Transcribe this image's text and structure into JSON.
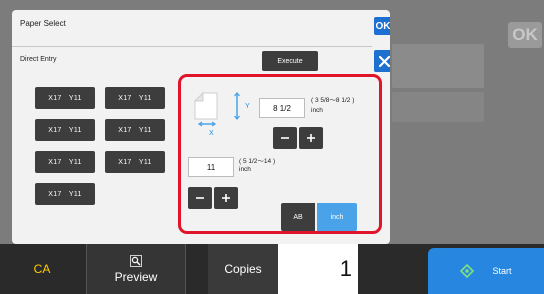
{
  "dialog": {
    "title": "Paper Select",
    "ok_label": "OK",
    "subtitle": "Direct Entry",
    "execute_label": "Execute",
    "close_icon": "close-icon",
    "presets": [
      "X17　Y11",
      "X17　Y11",
      "X17　Y11",
      "X17　Y11",
      "X17　Y11",
      "X17　Y11",
      "X17　Y11"
    ]
  },
  "entry": {
    "y_label": "Y",
    "y_value": "8 1/2",
    "y_range": "( 3 5/8～8 1/2 )",
    "y_unit": "inch",
    "x_label": "X",
    "x_value": "11",
    "x_range": "( 5 1/2～14 )",
    "x_unit": "inch",
    "minus_icon": "minus-icon",
    "plus_icon": "plus-icon",
    "unit_ab": "AB",
    "unit_inch": "inch",
    "selected_unit": "inch"
  },
  "background": {
    "ok_label": "OK"
  },
  "bottom": {
    "ca_label": "CA",
    "preview_label": "Preview",
    "preview_icon": "magnifier-icon",
    "copies_label": "Copies",
    "copies_value": "1",
    "start_label": "Start",
    "start_icon": "start-diamond-icon"
  },
  "colors": {
    "accent_blue": "#1d6fd0",
    "start_blue": "#2787e0",
    "highlight_red": "#e0142b",
    "inch_selected": "#4aa3e8",
    "ca_yellow": "#ffcc00",
    "dark_button": "#3d3d3d"
  }
}
